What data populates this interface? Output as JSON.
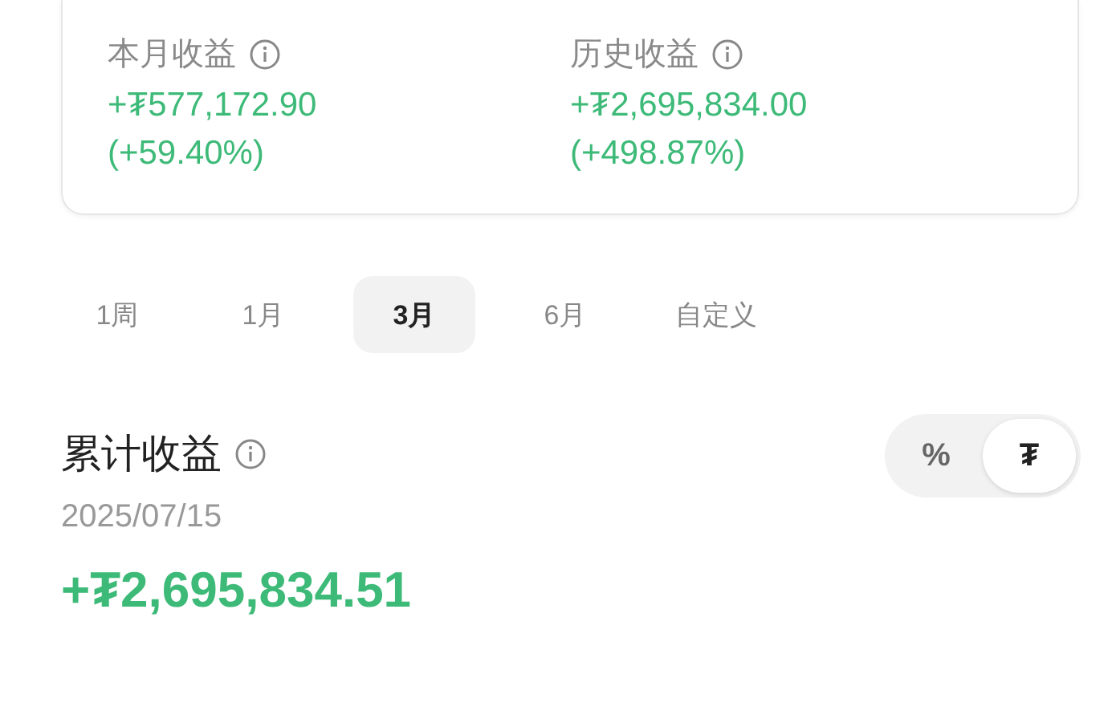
{
  "summary": [
    {
      "label": "本月收益",
      "value": "+₮577,172.90",
      "change": "(+59.40%)"
    },
    {
      "label": "历史收益",
      "value": "+₮2,695,834.00",
      "change": "(+498.87%)"
    }
  ],
  "periods": [
    {
      "label": "1周",
      "selected": false
    },
    {
      "label": "1月",
      "selected": false
    },
    {
      "label": "3月",
      "selected": true
    },
    {
      "label": "6月",
      "selected": false
    },
    {
      "label": "自定义",
      "selected": false
    }
  ],
  "cumulative": {
    "title": "累计收益",
    "date": "2025/07/15",
    "value": "+₮2,695,834.51"
  },
  "unit_toggle": [
    {
      "label": "%",
      "selected": false
    },
    {
      "label": "₮",
      "selected": true
    }
  ]
}
